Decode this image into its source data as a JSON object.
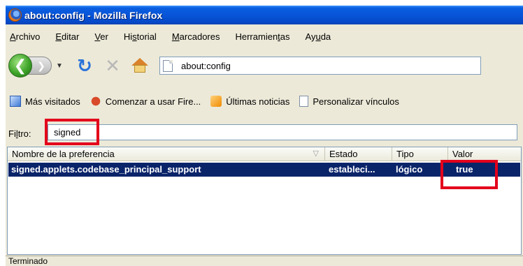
{
  "window": {
    "title": "about:config - Mozilla Firefox"
  },
  "menubar": {
    "items": [
      {
        "pre": "",
        "acc": "A",
        "post": "rchivo"
      },
      {
        "pre": "",
        "acc": "E",
        "post": "ditar"
      },
      {
        "pre": "",
        "acc": "V",
        "post": "er"
      },
      {
        "pre": "Hi",
        "acc": "s",
        "post": "torial"
      },
      {
        "pre": "",
        "acc": "M",
        "post": "arcadores"
      },
      {
        "pre": "Herramien",
        "acc": "t",
        "post": "as"
      },
      {
        "pre": "Ay",
        "acc": "u",
        "post": "da"
      }
    ]
  },
  "navbar": {
    "url": "about:config",
    "icons": {
      "back": "back-arrow-icon",
      "forward": "forward-arrow-icon",
      "reload": "reload-icon",
      "stop": "stop-icon",
      "home": "home-icon"
    }
  },
  "bookmarks": [
    {
      "label": "Más visitados",
      "icon": "blue"
    },
    {
      "label": "Comenzar a usar Fire...",
      "icon": "red"
    },
    {
      "label": "Últimas noticias",
      "icon": "rss"
    },
    {
      "label": "Personalizar vínculos",
      "icon": "doc"
    }
  ],
  "filter": {
    "label_pre": "Fi",
    "label_acc": "l",
    "label_post": "tro:",
    "value": "signed"
  },
  "table": {
    "columns": [
      "Nombre de la preferencia",
      "Estado",
      "Tipo",
      "Valor"
    ],
    "rows": [
      {
        "name": "signed.applets.codebase_principal_support",
        "state": "estableci...",
        "type": "lógico",
        "value": "true"
      }
    ]
  },
  "status": {
    "text": "Terminado"
  },
  "colors": {
    "selection": "#0a246a",
    "highlight_box": "#e3001b",
    "titlebar": "#0854d8"
  }
}
